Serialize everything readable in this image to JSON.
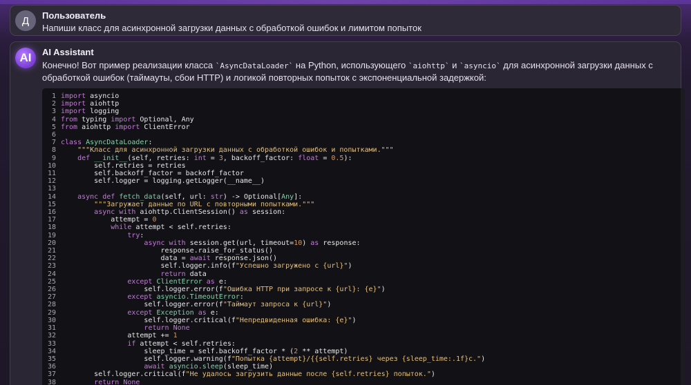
{
  "user": {
    "avatar_letter": "Д",
    "author": "Пользователь",
    "message": "Напиши класс для асинхронной загрузки данных с обработкой ошибок и лимитом попыток"
  },
  "assistant": {
    "avatar_label": "AI",
    "author": "AI Assistant",
    "intro_a": "Конечно! Вот пример реализации класса ",
    "intro_code1": "`AsyncDataLoader`",
    "intro_b": " на Python, использующего ",
    "intro_code2": "`aiohttp`",
    "intro_c": " и ",
    "intro_code3": "`asyncio`",
    "intro_d": " для асинхронной загрузки данных с обработкой ошибок (таймауты, сбои HTTP) и логикой повторных попыток с экспоненциальной задержкой:"
  },
  "code_lines": [
    [
      [
        "kw",
        "import"
      ],
      [
        "t",
        " asyncio"
      ]
    ],
    [
      [
        "kw",
        "import"
      ],
      [
        "t",
        " aiohttp"
      ]
    ],
    [
      [
        "kw",
        "import"
      ],
      [
        "t",
        " logging"
      ]
    ],
    [
      [
        "kw",
        "from"
      ],
      [
        "t",
        " typing "
      ],
      [
        "kw",
        "import"
      ],
      [
        "t",
        " Optional, Any"
      ]
    ],
    [
      [
        "kw",
        "from"
      ],
      [
        "t",
        " aiohttp "
      ],
      [
        "kw",
        "import"
      ],
      [
        "t",
        " ClientError"
      ]
    ],
    [],
    [
      [
        "kw",
        "class"
      ],
      [
        "t",
        " "
      ],
      [
        "cls",
        "AsyncDataLoader"
      ],
      [
        "t",
        ":"
      ]
    ],
    [
      [
        "t",
        "    "
      ],
      [
        "str",
        "\"\"\"Класс для асинхронной загрузки данных с обработкой ошибок и попытками.\"\"\""
      ]
    ],
    [
      [
        "t",
        "    "
      ],
      [
        "kw",
        "def"
      ],
      [
        "t",
        " "
      ],
      [
        "cls",
        "__init__"
      ],
      [
        "t",
        "(self, retries: "
      ],
      [
        "kw",
        "int"
      ],
      [
        "t",
        " = "
      ],
      [
        "num",
        "3"
      ],
      [
        "t",
        ", backoff_factor: "
      ],
      [
        "kw",
        "float"
      ],
      [
        "t",
        " = "
      ],
      [
        "num",
        "0.5"
      ],
      [
        "t",
        "):"
      ]
    ],
    [
      [
        "t",
        "        self.retries = retries"
      ]
    ],
    [
      [
        "t",
        "        self.backoff_factor = backoff_factor"
      ]
    ],
    [
      [
        "t",
        "        self.logger = logging.getLogger(__name__)"
      ]
    ],
    [],
    [
      [
        "t",
        "    "
      ],
      [
        "kw",
        "async def"
      ],
      [
        "t",
        " "
      ],
      [
        "cls",
        "fetch_data"
      ],
      [
        "t",
        "(self, url: "
      ],
      [
        "kw",
        "str"
      ],
      [
        "t",
        ") -> Optional["
      ],
      [
        "cls",
        "Any"
      ],
      [
        "t",
        "]:"
      ]
    ],
    [
      [
        "t",
        "        "
      ],
      [
        "str",
        "\"\"\"Загружает данные по URL с повторными попытками.\"\"\""
      ]
    ],
    [
      [
        "t",
        "        "
      ],
      [
        "kw",
        "async with"
      ],
      [
        "t",
        " aiohttp.ClientSession() "
      ],
      [
        "kw",
        "as"
      ],
      [
        "t",
        " session:"
      ]
    ],
    [
      [
        "t",
        "            attempt = "
      ],
      [
        "num",
        "0"
      ]
    ],
    [
      [
        "t",
        "            "
      ],
      [
        "kw",
        "while"
      ],
      [
        "t",
        " attempt < self.retries:"
      ]
    ],
    [
      [
        "t",
        "                "
      ],
      [
        "kw",
        "try"
      ],
      [
        "t",
        ":"
      ]
    ],
    [
      [
        "t",
        "                    "
      ],
      [
        "kw",
        "async with"
      ],
      [
        "t",
        " session.get(url, timeout="
      ],
      [
        "num",
        "10"
      ],
      [
        "t",
        ") "
      ],
      [
        "kw",
        "as"
      ],
      [
        "t",
        " response:"
      ]
    ],
    [
      [
        "t",
        "                        response.raise_for_status()"
      ]
    ],
    [
      [
        "t",
        "                        data = "
      ],
      [
        "kw",
        "await"
      ],
      [
        "t",
        " response.json()"
      ]
    ],
    [
      [
        "t",
        "                        self.logger.info(f"
      ],
      [
        "str",
        "\"Успешно загружено с {url}\""
      ],
      [
        "t",
        ")"
      ]
    ],
    [
      [
        "t",
        "                        "
      ],
      [
        "kw",
        "return"
      ],
      [
        "t",
        " data"
      ]
    ],
    [
      [
        "t",
        "                "
      ],
      [
        "kw",
        "except"
      ],
      [
        "t",
        " "
      ],
      [
        "cls",
        "ClientError"
      ],
      [
        "t",
        " "
      ],
      [
        "kw",
        "as"
      ],
      [
        "t",
        " e:"
      ]
    ],
    [
      [
        "t",
        "                    self.logger.error(f"
      ],
      [
        "str",
        "\"Ошибка HTTP при запросе к {url}: {e}\""
      ],
      [
        "t",
        ")"
      ]
    ],
    [
      [
        "t",
        "                "
      ],
      [
        "kw",
        "except"
      ],
      [
        "t",
        " "
      ],
      [
        "cls",
        "asyncio.TimeoutError"
      ],
      [
        "t",
        ":"
      ]
    ],
    [
      [
        "t",
        "                    self.logger.error(f"
      ],
      [
        "str",
        "\"Таймаут запроса к {url}\""
      ],
      [
        "t",
        ")"
      ]
    ],
    [
      [
        "t",
        "                "
      ],
      [
        "kw",
        "except"
      ],
      [
        "t",
        " "
      ],
      [
        "cls",
        "Exception"
      ],
      [
        "t",
        " "
      ],
      [
        "kw",
        "as"
      ],
      [
        "t",
        " e:"
      ]
    ],
    [
      [
        "t",
        "                    self.logger.critical(f"
      ],
      [
        "str",
        "\"Непредвиденная ошибка: {e}\""
      ],
      [
        "t",
        ")"
      ]
    ],
    [
      [
        "t",
        "                    "
      ],
      [
        "kw",
        "return"
      ],
      [
        "t",
        " "
      ],
      [
        "kw",
        "None"
      ]
    ],
    [
      [
        "t",
        "                attempt += "
      ],
      [
        "num",
        "1"
      ]
    ],
    [
      [
        "t",
        "                "
      ],
      [
        "kw",
        "if"
      ],
      [
        "t",
        " attempt < self.retries:"
      ]
    ],
    [
      [
        "t",
        "                    sleep_time = self.backoff_factor * ("
      ],
      [
        "num",
        "2"
      ],
      [
        "t",
        " ** attempt)"
      ]
    ],
    [
      [
        "t",
        "                    self.logger.warning(f"
      ],
      [
        "str",
        "\"Попытка {attempt}/{{self.retries} через {sleep_time:.1f}с.\""
      ],
      [
        "t",
        ")"
      ]
    ],
    [
      [
        "t",
        "                    "
      ],
      [
        "kw",
        "await"
      ],
      [
        "t",
        " "
      ],
      [
        "cls",
        "asyncio.sleep"
      ],
      [
        "t",
        "(sleep_time)"
      ]
    ],
    [
      [
        "t",
        "        self.logger.critical(f"
      ],
      [
        "str",
        "\"Не удалось загрузить данные после {self.retries} попыток.\""
      ],
      [
        "t",
        ")"
      ]
    ],
    [
      [
        "t",
        "        "
      ],
      [
        "kw",
        "return"
      ],
      [
        "t",
        " "
      ],
      [
        "kw",
        "None"
      ]
    ]
  ]
}
